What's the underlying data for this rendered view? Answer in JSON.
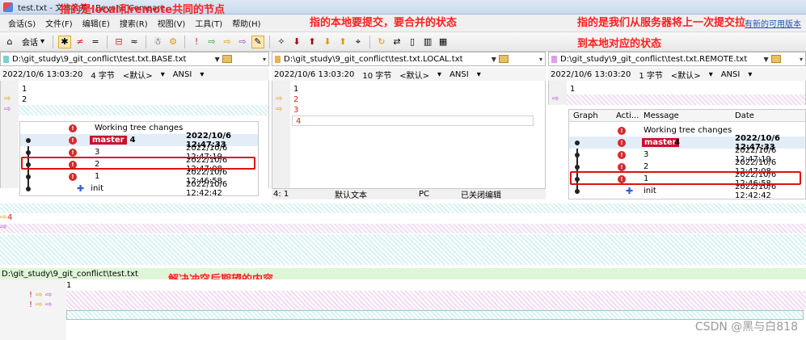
{
  "window": {
    "title": "test.txt - 文本合并 - Beyond Compare"
  },
  "menu": {
    "items": [
      "会话(S)",
      "文件(F)",
      "编辑(E)",
      "搜索(R)",
      "视图(V)",
      "工具(T)",
      "帮助(H)"
    ],
    "update_link": "有新的可用版本"
  },
  "toolbar": {
    "session_label": "会话"
  },
  "annotations": {
    "base": "指的是local和remote共同的节点",
    "local": "指的本地要提交，要合并的状态",
    "remote_line1": "指的是我们从服务器将上一次提交拉",
    "remote_line2": "到本地对应的状态",
    "output": "解决冲突后期望的内容"
  },
  "panes": {
    "base": {
      "path": "D:\\git_study\\9_git_conflict\\test.txt.BASE.txt",
      "timestamp": "2022/10/6 13:03:20",
      "size": "4 字节",
      "encoding_default": "<默认>",
      "encoding": "ANSI",
      "lines": [
        "1",
        "2"
      ]
    },
    "local": {
      "path": "D:\\git_study\\9_git_conflict\\test.txt.LOCAL.txt",
      "timestamp": "2022/10/6 13:03:20",
      "size": "10 字节",
      "encoding_default": "<默认>",
      "encoding": "ANSI",
      "lines": [
        "1",
        "2",
        "3",
        "4"
      ],
      "status": {
        "pos": "4: 1",
        "type": "默认文本",
        "eol": "PC",
        "edit": "已关闭编辑"
      }
    },
    "remote": {
      "path": "D:\\git_study\\9_git_conflict\\test.txt.REMOTE.txt",
      "timestamp": "2022/10/6 13:03:20",
      "size": "1 字节",
      "encoding_default": "<默认>",
      "encoding": "ANSI",
      "lines": [
        "1"
      ]
    }
  },
  "gitlog_left": {
    "rows": [
      {
        "message": "Working tree changes",
        "date": ""
      },
      {
        "branch": "master",
        "message": "4",
        "date": "2022/10/6 12:47:33"
      },
      {
        "message": "3",
        "date": "2022/10/6 12:47:19"
      },
      {
        "message": "2",
        "date": "2022/10/6 12:47:08"
      },
      {
        "message": "1",
        "date": "2022/10/6 12:46:58"
      },
      {
        "message": "init",
        "date": "2022/10/6 12:42:42"
      }
    ]
  },
  "gitlog_right": {
    "headers": [
      "Graph",
      "Acti...",
      "Message",
      "Date"
    ],
    "rows": [
      {
        "message": "Working tree changes",
        "date": ""
      },
      {
        "branch": "master",
        "message": "4",
        "date": "2022/10/6 12:47:33"
      },
      {
        "message": "3",
        "date": "2022/10/6 12:47:19"
      },
      {
        "message": "2",
        "date": "2022/10/6 12:47:08"
      },
      {
        "message": "1",
        "date": "2022/10/6 12:46:58"
      },
      {
        "message": "init",
        "date": "2022/10/6 12:42:42"
      }
    ]
  },
  "lower_compare": {
    "line_number": "4"
  },
  "output": {
    "path": "D:\\git_study\\9_git_conflict\\test.txt",
    "lines": [
      "1"
    ]
  },
  "watermark": "CSDN @黑与白818"
}
